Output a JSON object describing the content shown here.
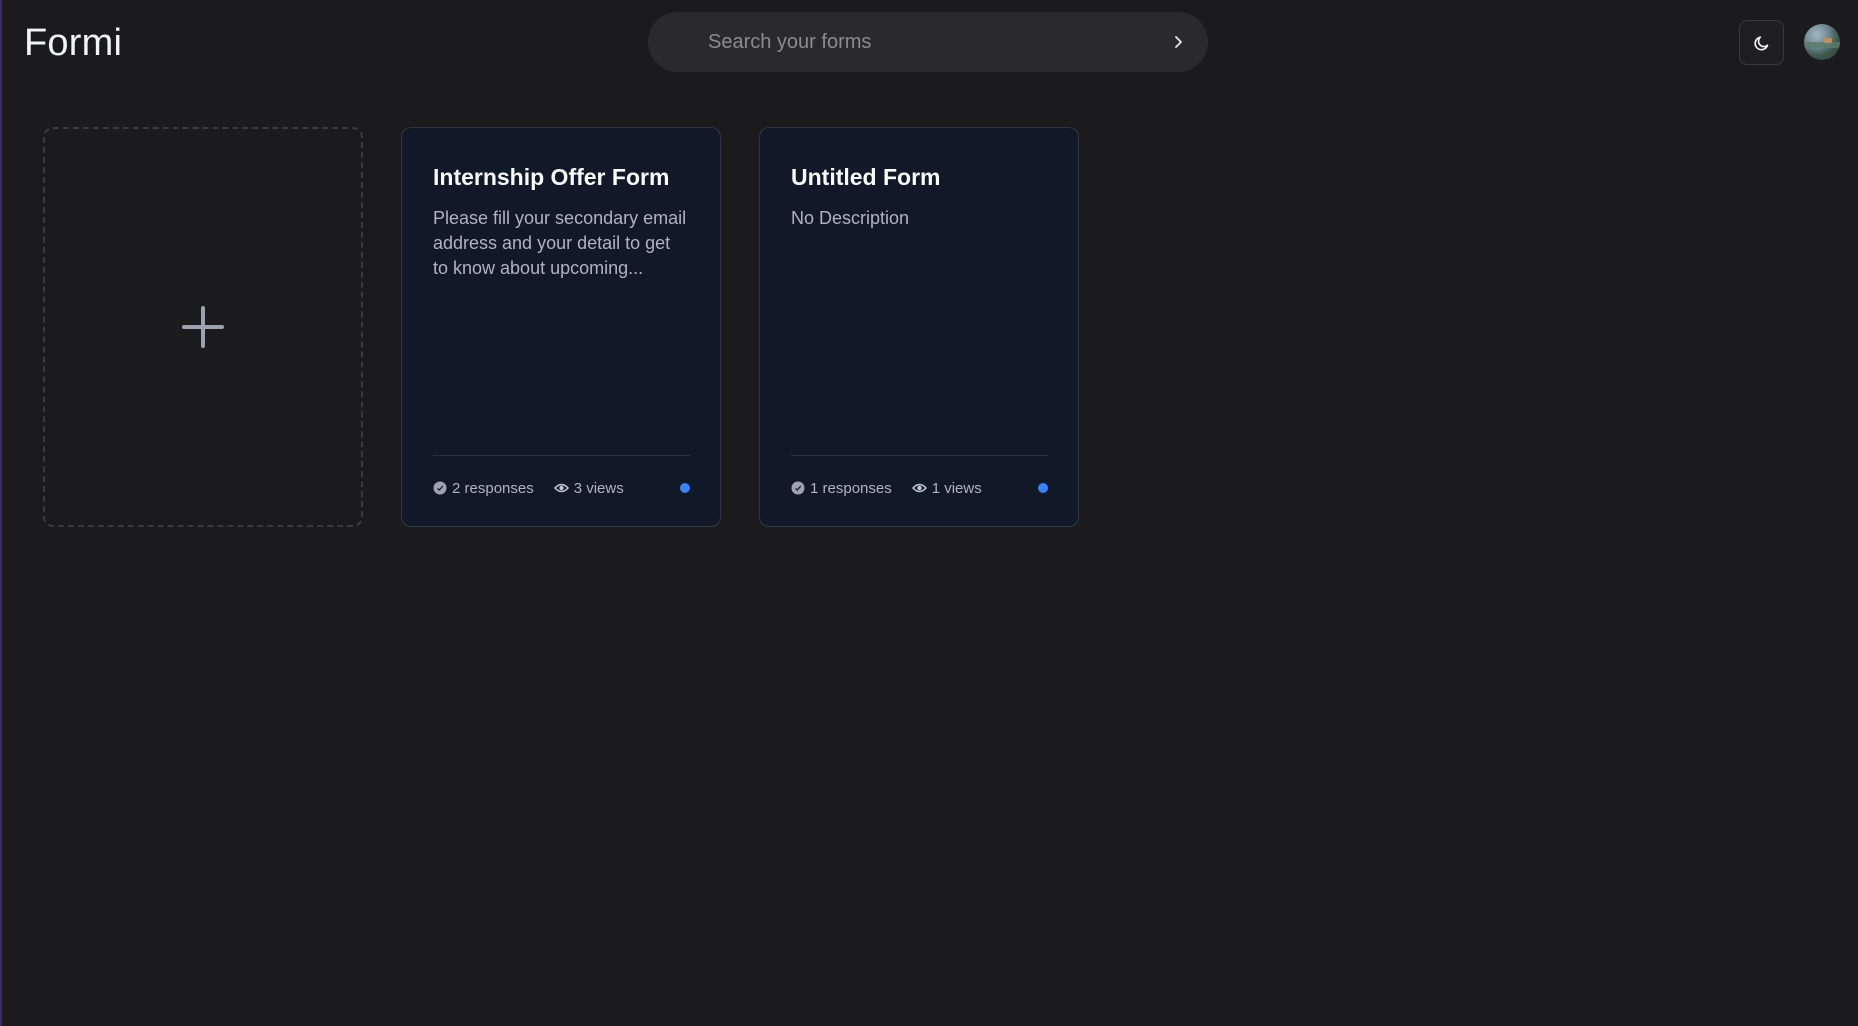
{
  "app": {
    "name": "Formi"
  },
  "search": {
    "placeholder": "Search your forms",
    "value": ""
  },
  "header": {
    "theme_icon": "moon-icon",
    "avatar_icon": "avatar"
  },
  "new_form": {
    "icon": "plus-icon"
  },
  "forms": [
    {
      "title": "Internship Offer Form",
      "description": "Please fill your secondary email address and your detail to get to know about upcoming...",
      "responses": "2 responses",
      "views": "3 views",
      "status_color": "#3b82f6"
    },
    {
      "title": "Untitled Form",
      "description": "No Description",
      "responses": "1 responses",
      "views": "1 views",
      "status_color": "#3b82f6"
    }
  ],
  "colors": {
    "background": "#1b1b1d",
    "card_background": "#111827",
    "accent": "#3b82f6"
  }
}
